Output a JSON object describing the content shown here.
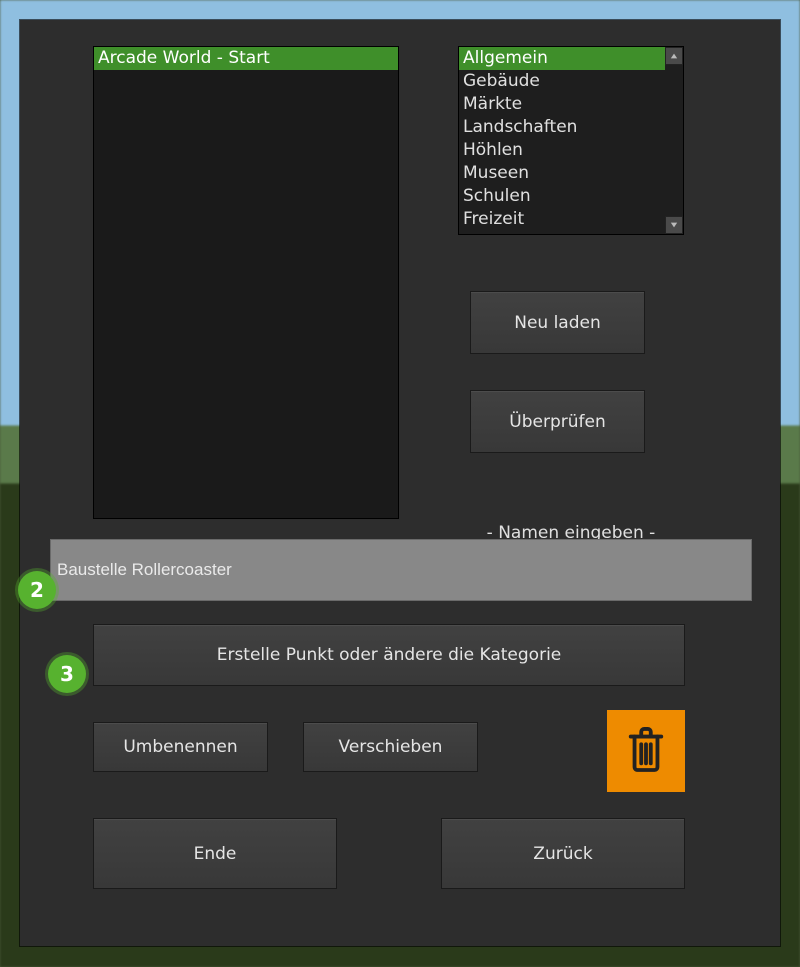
{
  "listbox": {
    "title": "Arcade World - Start"
  },
  "categories": {
    "items": [
      "Allgemein",
      "Gebäude",
      "Märkte",
      "Landschaften",
      "Höhlen",
      "Museen",
      "Schulen",
      "Freizeit"
    ],
    "selected_index": 0
  },
  "buttons": {
    "reload": "Neu laden",
    "check": "Überprüfen",
    "create": "Erstelle Punkt oder ändere die Kategorie",
    "rename": "Umbenennen",
    "move": "Verschieben",
    "end": "Ende",
    "back": "Zurück"
  },
  "labels": {
    "enter_name": "- Namen eingeben -"
  },
  "name_input": {
    "value": "Baustelle Rollercoaster"
  },
  "badges": {
    "b2": "2",
    "b3": "3"
  }
}
